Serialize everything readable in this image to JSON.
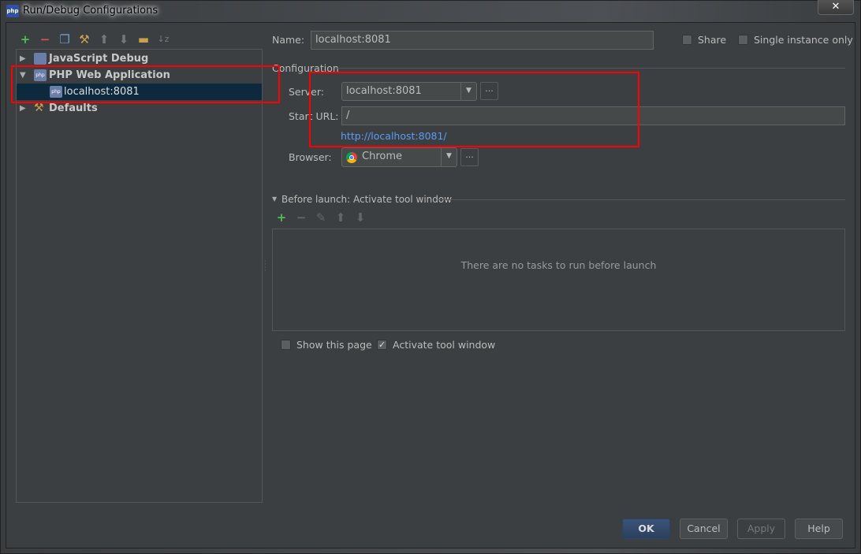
{
  "window": {
    "title": "Run/Debug Configurations",
    "close": "✕",
    "app_icon": "php"
  },
  "toolbar": {
    "icons": [
      "add-icon",
      "remove-icon",
      "copy-icon",
      "edit-defaults-icon",
      "move-up-icon",
      "move-down-icon",
      "folder-icon",
      "sort-icon"
    ]
  },
  "tree": [
    {
      "label": "JavaScript Debug",
      "expanded": false,
      "bold": true
    },
    {
      "label": "PHP Web Application",
      "expanded": true,
      "bold": true
    },
    {
      "label": "localhost:8081",
      "selected": true
    },
    {
      "label": "Defaults",
      "expanded": false,
      "bold": true
    }
  ],
  "form": {
    "name_label": "Name:",
    "name_value": "localhost:8081",
    "share_label": "Share",
    "single_instance_label": "Single instance only",
    "configuration_label": "Configuration",
    "server_label": "Server:",
    "server_value": "localhost:8081",
    "start_url_label": "Start URL:",
    "start_url_value": "/",
    "resolved_url": "http://localhost:8081/",
    "browser_label": "Browser:",
    "browser_value": "Chrome",
    "more": "···"
  },
  "before_launch": {
    "title": "Before launch: Activate tool window",
    "empty_text": "There are no tasks to run before launch",
    "show_page_label": "Show this page",
    "show_page_checked": false,
    "activate_label": "Activate tool window",
    "activate_checked": true
  },
  "buttons": {
    "ok": "OK",
    "cancel": "Cancel",
    "apply": "Apply",
    "help": "Help"
  },
  "colors": {
    "bg": "#3c3f41",
    "selection": "#0d293e",
    "link": "#589df6",
    "annotation": "#ff0000"
  }
}
